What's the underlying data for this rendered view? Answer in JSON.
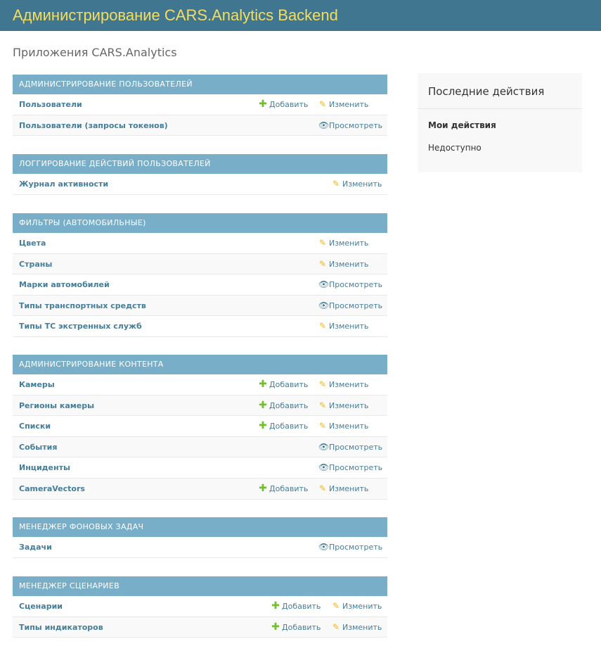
{
  "header": {
    "site_name": "Администрирование CARS.Analytics Backend"
  },
  "page_title": "Приложения CARS.Analytics",
  "actions": {
    "add": "Добавить",
    "change": "Изменить",
    "view": "Просмотреть"
  },
  "modules": [
    {
      "title": "Администрирование пользователей",
      "models": [
        {
          "name": "Пользователи",
          "actions": [
            "add",
            "change"
          ]
        },
        {
          "name": "Пользователи (запросы токенов)",
          "actions": [
            "view"
          ]
        }
      ]
    },
    {
      "title": "Логгирование действий пользователей",
      "models": [
        {
          "name": "Журнал активности",
          "actions": [
            "change"
          ]
        }
      ]
    },
    {
      "title": "Фильтры (автомобильные)",
      "models": [
        {
          "name": "Цвета",
          "actions": [
            "change"
          ]
        },
        {
          "name": "Страны",
          "actions": [
            "change"
          ]
        },
        {
          "name": "Марки автомобилей",
          "actions": [
            "view"
          ]
        },
        {
          "name": "Типы транспортных средств",
          "actions": [
            "view"
          ]
        },
        {
          "name": "Типы ТС экстренных служб",
          "actions": [
            "change"
          ]
        }
      ]
    },
    {
      "title": "Администрирование контента",
      "models": [
        {
          "name": "Камеры",
          "actions": [
            "add",
            "change"
          ]
        },
        {
          "name": "Регионы камеры",
          "actions": [
            "add",
            "change"
          ]
        },
        {
          "name": "Списки",
          "actions": [
            "add",
            "change"
          ]
        },
        {
          "name": "События",
          "actions": [
            "view"
          ]
        },
        {
          "name": "Инциденты",
          "actions": [
            "view"
          ]
        },
        {
          "name": "CameraVectors",
          "actions": [
            "add",
            "change"
          ]
        }
      ]
    },
    {
      "title": "Менеджер фоновых задач",
      "models": [
        {
          "name": "Задачи",
          "actions": [
            "view"
          ]
        }
      ]
    },
    {
      "title": "Менеджер сценариев",
      "models": [
        {
          "name": "Сценарии",
          "actions": [
            "add",
            "change"
          ]
        },
        {
          "name": "Типы индикаторов",
          "actions": [
            "add",
            "change"
          ]
        }
      ]
    }
  ],
  "recent_actions": {
    "title": "Последние действия",
    "my_actions": "Мои действия",
    "none_available": "Недоступно"
  },
  "icons": {
    "add": "plus-icon",
    "change": "pencil-icon",
    "view": "eye-icon"
  },
  "colors": {
    "header_bg": "#417690",
    "site_name": "#f5dd5d",
    "module_header_bg": "#79aec8",
    "link": "#447e9b",
    "add_icon": "#70bf2b",
    "change_icon": "#efb80b"
  }
}
